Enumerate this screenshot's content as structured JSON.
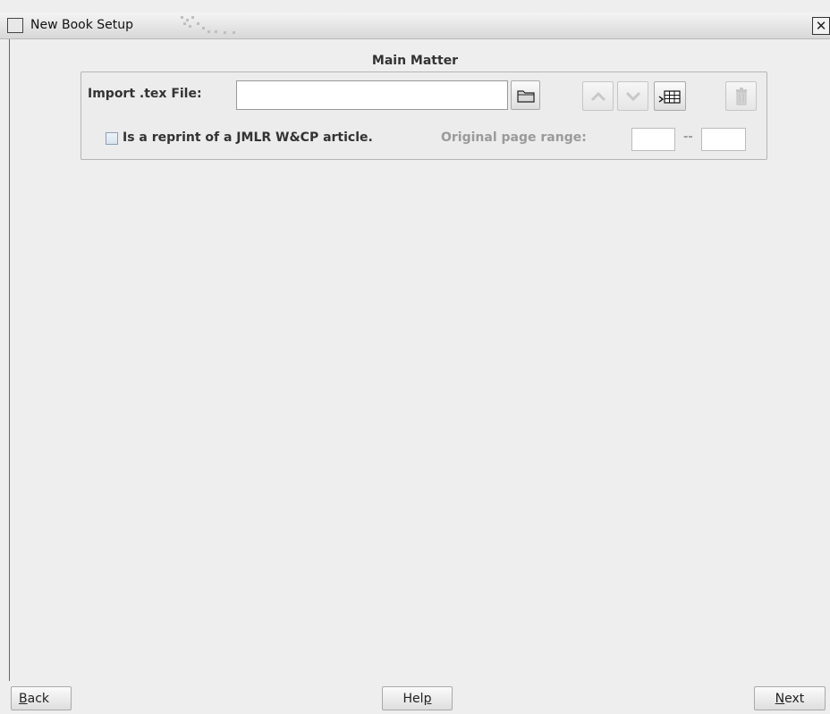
{
  "window": {
    "title": "New Book Setup",
    "close_label": "✕"
  },
  "section": {
    "title": "Main Matter"
  },
  "import": {
    "label": "Import .tex File:",
    "value": "",
    "placeholder": ""
  },
  "toolbar": {
    "browse_icon": "folder-icon",
    "move_up_icon": "arrow-up-icon",
    "move_down_icon": "arrow-down-icon",
    "insert_table_icon": "insert-table-icon",
    "delete_icon": "trash-icon"
  },
  "reprint": {
    "checkbox_label": "Is a reprint of a JMLR W&CP article.",
    "checked": false,
    "page_range_label": "Original page range:",
    "range_start": "",
    "range_separator": "--",
    "range_end": ""
  },
  "footer": {
    "back_mnemonic": "B",
    "back_rest": "ack",
    "help_prefix": "Hel",
    "help_mnemonic": "p",
    "next_mnemonic": "N",
    "next_rest": "ext"
  },
  "colors": {
    "window_bg": "#eeeeee",
    "panel_border": "#b5b5b5",
    "disabled_text": "#9a9a9a"
  }
}
